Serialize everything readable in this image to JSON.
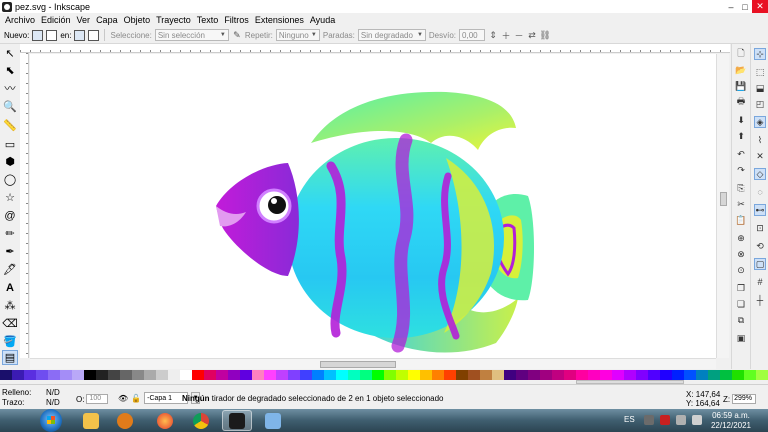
{
  "window": {
    "title": "pez.svg - Inkscape",
    "controls": {
      "minimize": "–",
      "maximize": "□",
      "close": "✕"
    }
  },
  "menu": [
    {
      "label": "Archivo"
    },
    {
      "label": "Edición"
    },
    {
      "label": "Ver"
    },
    {
      "label": "Capa"
    },
    {
      "label": "Objeto"
    },
    {
      "label": "Trayecto"
    },
    {
      "label": "Texto"
    },
    {
      "label": "Filtros"
    },
    {
      "label": "Extensiones"
    },
    {
      "label": "Ayuda"
    }
  ],
  "controls_bar": {
    "nuevo_label": "Nuevo:",
    "en_label": "en:",
    "seleccione_label": "Seleccione:",
    "seleccione_value": "Sin selección",
    "repetir_label": "Repetir:",
    "repetir_value": "Ninguno",
    "paradas_label": "Paradas:",
    "paradas_value": "Sin degradado",
    "desvio_label": "Desvío:",
    "desvio_value": "0,00"
  },
  "status": {
    "relleno_label": "Relleno:",
    "trazo_label": "Trazo:",
    "relleno_value": "N/D",
    "trazo_value": "N/D",
    "opacity_label": "O:",
    "opacity_value": "100",
    "layer": "-Capa 1",
    "message_bold": "Ningún",
    "message_rest": " tirador de degradado seleccionado de 2 en 1 objeto seleccionado",
    "x_label": "X:",
    "x_value": "147,64",
    "y_label": "Y:",
    "y_value": "164,64",
    "zoom_label": "Z:",
    "zoom_value": "299%"
  },
  "taskbar": {
    "language": "ES",
    "time": "06:59 a.m.",
    "date": "22/12/2021"
  },
  "colors": {
    "accent": "#7aa7dd",
    "close_red": "#e81123",
    "fish_body_cyan": "#2fd8f5",
    "fish_stripe_purple": "#b21fd8",
    "fish_fin_yellow": "#d7f03a"
  },
  "palette": [
    "#1a0f6b",
    "#3b1bb3",
    "#5a2fe0",
    "#6f4df0",
    "#8b6cf5",
    "#a48df7",
    "#b9a8f8",
    "#000000",
    "#222222",
    "#444444",
    "#666666",
    "#888888",
    "#aaaaaa",
    "#cccccc",
    "#eeeeee",
    "#ffffff",
    "#ff0000",
    "#e00060",
    "#c000a0",
    "#9000c0",
    "#6000e0",
    "#ff80c0",
    "#ff40ff",
    "#c040ff",
    "#8040ff",
    "#4040ff",
    "#0080ff",
    "#00c0ff",
    "#00ffff",
    "#00ffc0",
    "#00ff80",
    "#00ff00",
    "#80ff00",
    "#c0ff00",
    "#ffff00",
    "#ffc000",
    "#ff8000",
    "#ff4000",
    "#804000",
    "#a05020",
    "#c08040",
    "#e0c080",
    "#400080",
    "#600080",
    "#800080",
    "#a00080",
    "#c00080",
    "#e00080",
    "#ff00a0",
    "#ff00c0",
    "#ff00e0",
    "#e000ff",
    "#b000ff",
    "#8000ff",
    "#5000ff",
    "#2000ff",
    "#0020ff",
    "#0050ff",
    "#0080c0",
    "#00a080",
    "#00c040",
    "#20e000",
    "#60ff20",
    "#a0ff40"
  ]
}
